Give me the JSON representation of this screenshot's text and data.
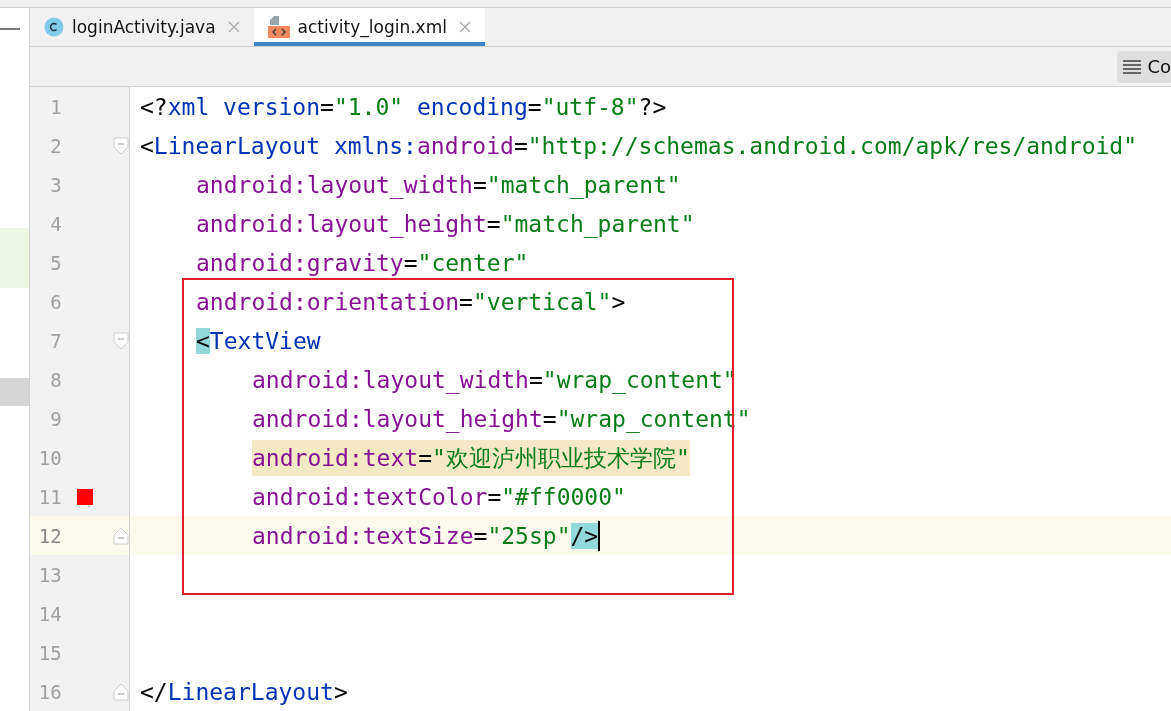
{
  "tabs": [
    {
      "label": "loginActivity.java",
      "kind": "java",
      "selected": false
    },
    {
      "label": "activity_login.xml",
      "kind": "xml",
      "selected": true
    }
  ],
  "toolbar": {
    "button_label": "Co"
  },
  "editor": {
    "lines": [
      {
        "number": "1",
        "current": false,
        "highlighted": false,
        "tokens": [
          {
            "t": "<?",
            "kind": "punct"
          },
          {
            "t": "xml",
            "kind": "tag"
          },
          {
            "t": " version",
            "kind": "tag"
          },
          {
            "t": "=",
            "kind": "punct"
          },
          {
            "t": "\"1.0\"",
            "kind": "value"
          },
          {
            "t": " encoding",
            "kind": "tag"
          },
          {
            "t": "=",
            "kind": "punct"
          },
          {
            "t": "\"utf-8\"",
            "kind": "value"
          },
          {
            "t": "?>",
            "kind": "punct"
          }
        ]
      },
      {
        "number": "2",
        "current": false,
        "highlighted": false,
        "fold": {
          "kind": "open"
        },
        "tokens": [
          {
            "t": "<",
            "kind": "punct"
          },
          {
            "t": "LinearLayout",
            "kind": "tag"
          },
          {
            "t": " xmlns:",
            "kind": "tag"
          },
          {
            "t": "android",
            "kind": "ns"
          },
          {
            "t": "=",
            "kind": "punct"
          },
          {
            "t": "\"http://schemas.android.com/apk/res/android\"",
            "kind": "value"
          }
        ],
        "children": [
          {
            "number": "3",
            "current": false,
            "highlighted": false,
            "tokens": [
              {
                "t": "android:layout_width",
                "kind": "ns"
              },
              {
                "t": "=",
                "kind": "punct"
              },
              {
                "t": "\"match_parent\"",
                "kind": "value"
              }
            ]
          },
          {
            "number": "4",
            "current": false,
            "highlighted": false,
            "tokens": [
              {
                "t": "android:layout_height",
                "kind": "ns"
              },
              {
                "t": "=",
                "kind": "punct"
              },
              {
                "t": "\"match_parent\"",
                "kind": "value"
              }
            ]
          },
          {
            "number": "5",
            "current": false,
            "highlighted": false,
            "tokens": [
              {
                "t": "android:gravity",
                "kind": "ns"
              },
              {
                "t": "=",
                "kind": "punct"
              },
              {
                "t": "\"center\"",
                "kind": "value"
              }
            ]
          },
          {
            "number": "6",
            "current": false,
            "highlighted": false,
            "tokens": [
              {
                "t": "android:orientation",
                "kind": "ns"
              },
              {
                "t": "=",
                "kind": "punct"
              },
              {
                "t": "\"vertical\"",
                "kind": "value"
              },
              {
                "t": ">",
                "kind": "punct"
              }
            ]
          },
          {
            "number": "7",
            "current": false,
            "highlighted": false,
            "fold": {
              "kind": "open"
            },
            "tokens": [
              {
                "t": "<",
                "kind": "punct",
                "matched": true
              },
              {
                "t": "TextView",
                "kind": "tag",
                "matched": false
              }
            ],
            "children": [
              {
                "number": "8",
                "current": false,
                "highlighted": false,
                "tokens": [
                  {
                    "t": "android:layout_width",
                    "kind": "ns"
                  },
                  {
                    "t": "=",
                    "kind": "punct"
                  },
                  {
                    "t": "\"wrap_content\"",
                    "kind": "value"
                  }
                ]
              },
              {
                "number": "9",
                "current": false,
                "highlighted": false,
                "tokens": [
                  {
                    "t": "android:layout_height",
                    "kind": "ns"
                  },
                  {
                    "t": "=",
                    "kind": "punct"
                  },
                  {
                    "t": "\"wrap_content\"",
                    "kind": "value"
                  }
                ]
              },
              {
                "number": "10",
                "current": false,
                "highlighted": true,
                "tokens": [
                  {
                    "t": "android:text",
                    "kind": "ns"
                  },
                  {
                    "t": "=",
                    "kind": "punct"
                  },
                  {
                    "t": "\"欢迎泸州职业技术学院\"",
                    "kind": "value"
                  }
                ]
              },
              {
                "number": "11",
                "current": false,
                "highlighted": false,
                "marker": {
                  "color": "#ff0000"
                },
                "tokens": [
                  {
                    "t": "android:textColor",
                    "kind": "ns"
                  },
                  {
                    "t": "=",
                    "kind": "punct"
                  },
                  {
                    "t": "\"#ff0000\"",
                    "kind": "value"
                  }
                ]
              },
              {
                "number": "12",
                "current": true,
                "highlighted": false,
                "fold": {
                  "kind": "close"
                },
                "tokens": [
                  {
                    "t": "android:textSize",
                    "kind": "ns"
                  },
                  {
                    "t": "=",
                    "kind": "punct"
                  },
                  {
                    "t": "\"25sp\"",
                    "kind": "value",
                    "matched": false
                  },
                  {
                    "t": "/>",
                    "kind": "punct",
                    "matched": true
                  }
                ]
              }
            ]
          },
          {
            "number": "13",
            "current": false,
            "highlighted": false
          },
          {
            "number": "14",
            "current": false,
            "highlighted": false
          },
          {
            "number": "15",
            "current": false,
            "highlighted": false
          }
        ]
      },
      {
        "number": "16",
        "current": false,
        "highlighted": false,
        "fold": {
          "kind": "close"
        },
        "tokens": [
          {
            "t": "</",
            "kind": "punct"
          },
          {
            "t": "LinearLayout",
            "kind": "tag"
          },
          {
            "t": ">",
            "kind": "punct"
          }
        ]
      }
    ]
  }
}
